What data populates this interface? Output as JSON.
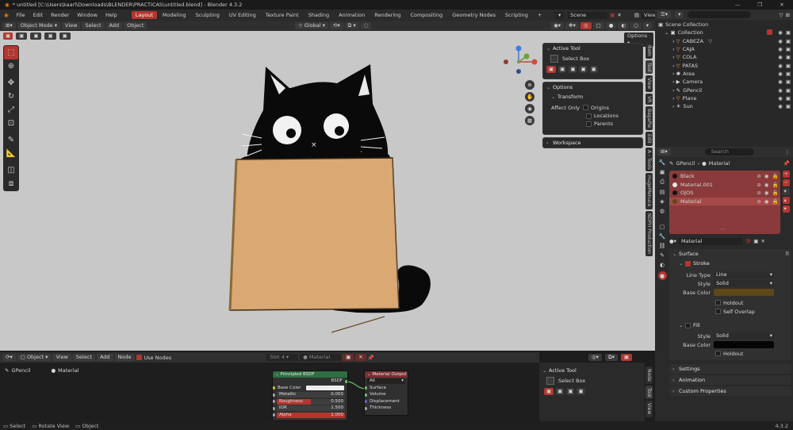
{
  "window": {
    "title": "* untitled [C:\\Users\\kaarl\\Downloads\\BLENDER\\PRACTICAS\\untitled.blend] - Blender 4.3.2"
  },
  "menus": [
    "File",
    "Edit",
    "Render",
    "Window",
    "Help"
  ],
  "workspaces": [
    {
      "label": "Layout",
      "active": true
    },
    {
      "label": "Modeling",
      "active": false
    },
    {
      "label": "Sculpting",
      "active": false
    },
    {
      "label": "UV Editing",
      "active": false
    },
    {
      "label": "Texture Paint",
      "active": false
    },
    {
      "label": "Shading",
      "active": false
    },
    {
      "label": "Animation",
      "active": false
    },
    {
      "label": "Rendering",
      "active": false
    },
    {
      "label": "Compositing",
      "active": false
    },
    {
      "label": "Geometry Nodes",
      "active": false
    },
    {
      "label": "Scripting",
      "active": false
    }
  ],
  "scene": {
    "name": "Scene",
    "view_layer": "ViewLayer"
  },
  "viewport_header": {
    "mode": "Object Mode",
    "menus": [
      "View",
      "Select",
      "Add",
      "Object"
    ],
    "transform_orientation": "Global",
    "options_label": "Options"
  },
  "n_panel": {
    "active_tool_title": "Active Tool",
    "tool_name": "Select Box",
    "options_title": "Options",
    "transform_title": "Transform",
    "affect_only_label": "Affect Only",
    "affect_only": [
      "Origins",
      "Locations",
      "Parents"
    ],
    "workspace_title": "Workspace",
    "tabs": [
      "Item",
      "Tool",
      "View",
      "VR",
      "BagaPie",
      "Edit",
      "A - Tools",
      "HugeMenuce",
      "NDPH Production"
    ]
  },
  "outliner": {
    "search_placeholder": "",
    "root": "Scene Collection",
    "collection": "Collection",
    "items": [
      {
        "name": "CABEZA",
        "indent": 2
      },
      {
        "name": "CAJA",
        "indent": 2
      },
      {
        "name": "COLA",
        "indent": 2
      },
      {
        "name": "PATAS",
        "indent": 2
      },
      {
        "name": "Area",
        "indent": 1
      },
      {
        "name": "Camera",
        "indent": 1
      },
      {
        "name": "GPencil",
        "indent": 1
      },
      {
        "name": "Plane",
        "indent": 1
      },
      {
        "name": "Sun",
        "indent": 1
      }
    ]
  },
  "properties": {
    "search_placeholder": "Search",
    "breadcrumb_object": "GPencil",
    "breadcrumb_material": "Material",
    "material_slots": [
      "Black",
      "Material.001",
      "OJOS",
      "Material"
    ],
    "selected_slot": "Material",
    "material_name": "Material",
    "surface_title": "Surface",
    "stroke_title": "Stroke",
    "line_type_label": "Line Type",
    "line_type_value": "Line",
    "style_label": "Style",
    "style_value": "Solid",
    "base_color_label": "Base Color",
    "holdout_label": "Holdout",
    "self_overlap_label": "Self Overlap",
    "fill_title": "Fill",
    "fill_style_label": "Style",
    "fill_style_value": "Solid",
    "fill_base_color_label": "Base Color",
    "fill_holdout_label": "Holdout",
    "settings_title": "Settings",
    "animation_title": "Animation",
    "custom_properties_title": "Custom Properties",
    "stroke_color": "#5e4718",
    "fill_color": "#050505"
  },
  "node_editor": {
    "type": "Object",
    "menus": [
      "View",
      "Select",
      "Add",
      "Node"
    ],
    "use_nodes_label": "Use Nodes",
    "slot_label": "Slot 4",
    "material_field": "Material",
    "breadcrumb_object": "GPencil",
    "breadcrumb_material": "Material",
    "principled": {
      "title": "Principled BSDF",
      "output": "BSDF",
      "inputs": [
        {
          "label": "Base Color",
          "value": ""
        },
        {
          "label": "Metallic",
          "value": "0.000"
        },
        {
          "label": "Roughness",
          "value": "0.500"
        },
        {
          "label": "IOR",
          "value": "1.500"
        },
        {
          "label": "Alpha",
          "value": "1.000"
        }
      ]
    },
    "material_output": {
      "title": "Material Output",
      "target": "All",
      "inputs": [
        "Surface",
        "Volume",
        "Displacement",
        "Thickness"
      ]
    },
    "side_panel": {
      "active_tool_title": "Active Tool",
      "tool_name": "Select Box",
      "tabs": [
        "Node",
        "Tool",
        "View"
      ]
    }
  },
  "statusbar": {
    "items": [
      "Select",
      "Rotate View",
      "Object"
    ],
    "version": "4.3.2"
  },
  "colors": {
    "accent": "#b3362f",
    "viewport_bg": "#c8c8c8",
    "box": "#d9a873"
  }
}
